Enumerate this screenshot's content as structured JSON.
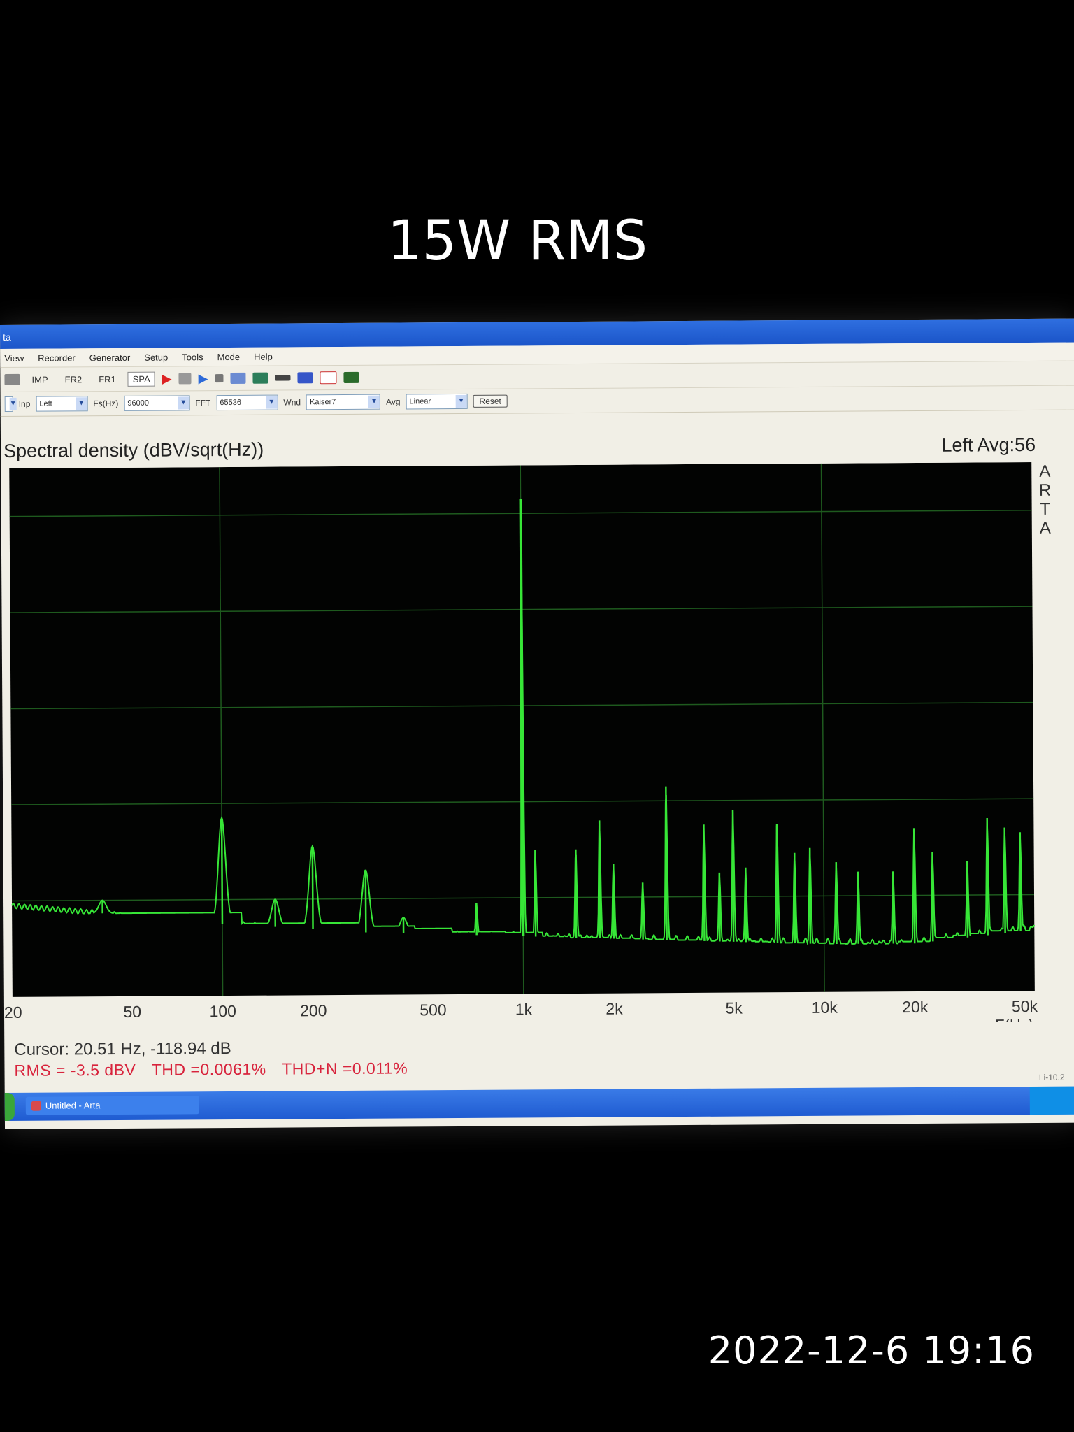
{
  "overlay": {
    "title": "15W RMS",
    "timestamp": "2022-12-6 19:16"
  },
  "window": {
    "title": "ta",
    "menu": [
      "View",
      "Recorder",
      "Generator",
      "Setup",
      "Tools",
      "Mode",
      "Help"
    ],
    "toolbar": {
      "modes": [
        "IMP",
        "FR2",
        "FR1",
        "SPA"
      ],
      "active_mode": "SPA"
    },
    "options": {
      "inp_label": "Inp",
      "inp_value": "Left",
      "fs_label": "Fs(Hz)",
      "fs_value": "96000",
      "fft_label": "FFT",
      "fft_value": "65536",
      "wnd_label": "Wnd",
      "wnd_value": "Kaiser7",
      "avg_label": "Avg",
      "avg_value": "Linear",
      "reset_label": "Reset"
    },
    "version": "Li-10.2"
  },
  "plot": {
    "header_left": "Spectral density (dBV/sqrt(Hz))",
    "header_right": "Left  Avg:56",
    "side_label": [
      "A",
      "R",
      "T",
      "A"
    ],
    "cursor": "Cursor: 20.51 Hz, -118.94 dB",
    "stats": {
      "rms": "RMS =  -3.5 dBV",
      "thd": "THD =0.0061%",
      "thdn": "THD+N =0.011%"
    },
    "colors": {
      "trace": "#37e637",
      "grid": "#1e5a1e",
      "stats": "#d8233c"
    }
  },
  "taskbar": {
    "item": "Untitled - Arta"
  },
  "chart_data": {
    "type": "line",
    "title": "Spectral density (dBV/sqrt(Hz))",
    "xlabel": "F(Hz)",
    "ylabel": "",
    "xscale": "log",
    "xlim": [
      20,
      50000
    ],
    "ylim": [
      -140,
      -30
    ],
    "grid": true,
    "x_tick_labels": [
      "20",
      "50",
      "100",
      "200",
      "500",
      "1k",
      "2k",
      "5k",
      "10k",
      "20k",
      "50k"
    ],
    "x_tick_values": [
      20,
      50,
      100,
      200,
      500,
      1000,
      2000,
      5000,
      10000,
      20000,
      50000
    ],
    "noise_floor": [
      [
        20,
        -121
      ],
      [
        30,
        -122
      ],
      [
        45,
        -123
      ],
      [
        60,
        -124
      ],
      [
        100,
        -125
      ],
      [
        300,
        -127
      ],
      [
        1000,
        -128
      ],
      [
        3000,
        -129
      ],
      [
        10000,
        -130
      ],
      [
        20000,
        -130
      ],
      [
        40000,
        -128
      ],
      [
        50000,
        -127
      ]
    ],
    "peaks": [
      {
        "x": 40,
        "y": -120
      },
      {
        "x": 100,
        "y": -103
      },
      {
        "x": 150,
        "y": -120
      },
      {
        "x": 200,
        "y": -109
      },
      {
        "x": 300,
        "y": -114
      },
      {
        "x": 400,
        "y": -124
      },
      {
        "x": 700,
        "y": -121
      },
      {
        "x": 1000,
        "y": -37
      },
      {
        "x": 1100,
        "y": -110
      },
      {
        "x": 1500,
        "y": -110
      },
      {
        "x": 1800,
        "y": -104
      },
      {
        "x": 2000,
        "y": -113
      },
      {
        "x": 2500,
        "y": -117
      },
      {
        "x": 3000,
        "y": -97
      },
      {
        "x": 4000,
        "y": -105
      },
      {
        "x": 4500,
        "y": -115
      },
      {
        "x": 5000,
        "y": -102
      },
      {
        "x": 5500,
        "y": -114
      },
      {
        "x": 7000,
        "y": -105
      },
      {
        "x": 8000,
        "y": -111
      },
      {
        "x": 9000,
        "y": -110
      },
      {
        "x": 11000,
        "y": -113
      },
      {
        "x": 13000,
        "y": -115
      },
      {
        "x": 17000,
        "y": -115
      },
      {
        "x": 20000,
        "y": -106
      },
      {
        "x": 23000,
        "y": -111
      },
      {
        "x": 30000,
        "y": -113
      },
      {
        "x": 35000,
        "y": -104
      },
      {
        "x": 40000,
        "y": -106
      },
      {
        "x": 45000,
        "y": -107
      }
    ]
  }
}
